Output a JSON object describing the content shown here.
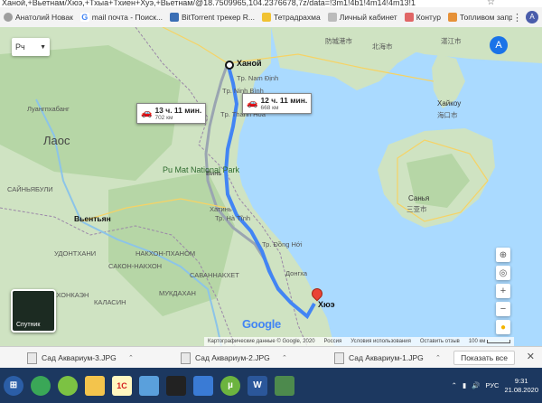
{
  "browser": {
    "url_fragment": "Ханой,+Вьетнам/Хюэ,+Тхыа+Тхиен+Хуэ,+Вьетнам/@18.7509965,104.2376678,7z/data=!3m1!4b1!4m14!4m13!1",
    "bookmarks": [
      {
        "label": "Анатолий Новак",
        "icon": "account-icon",
        "color": "#9e9e9e"
      },
      {
        "label": "mail почта - Поиск...",
        "icon": "google-g-icon",
        "color": "#4285f4"
      },
      {
        "label": "BitTorrent трекер R...",
        "icon": "torrent-icon",
        "color": "#3b6fb5"
      },
      {
        "label": "Тетрадрахма",
        "icon": "folder-icon",
        "color": "#f1c232"
      },
      {
        "label": "Личный кабинет",
        "icon": "link-icon",
        "color": "#777777"
      },
      {
        "label": "Контур",
        "icon": "kontur-icon",
        "color": "#e06666"
      },
      {
        "label": "Топливом заправи...",
        "icon": "fuel-icon",
        "color": "#e69138"
      }
    ],
    "profile_initial": "A"
  },
  "map": {
    "map_type_selector": "Рч",
    "profile_initial": "A",
    "labels": {
      "hanoi": "Ханой",
      "hue": "Хюэ",
      "laos": "Лаос",
      "vientiane": "Вьентьян",
      "luangprabang": "Луангпхабанг",
      "sanya": "Санья",
      "haikou": "Хайкоу",
      "vinh": "Винь",
      "pumat": "Pu Mat National Park",
      "dong_hoi": "Тр. Đồng Hới",
      "dong_ha": "Донгха",
      "ha_tinh": "Тр. Hà Tĩnh",
      "hatin": "Хатинь",
      "thanh_hoa": "Tp. Thanh Hóa",
      "nam_dinh": "Tp. Nam Định",
      "ninh_binh": "Tp. Ninh Bình",
      "khanhhoa": "САКОН-НАКХОН",
      "mukdahan": "МУКДАХАН",
      "nakhon": "НАКХОН-ПХАНОМ",
      "savannakhet": "САВАННАКХЕТ",
      "udon": "УДОНТХАНИ",
      "kalasin": "КАЛАСИН",
      "khonkaen": "КХОНКАЭН",
      "sainyabuli": "САЙНЬЯБУЛИ",
      "zhanjiang": "湛江市",
      "haikou_cn": "海口市",
      "sanya_cn": "三亚市",
      "beihai": "北海市",
      "fangcheng": "防城港市"
    },
    "route_primary": {
      "duration": "12 ч. 11 мин.",
      "distance": "668 км"
    },
    "route_alt": {
      "duration": "13 ч. 11 мин.",
      "distance": "702 км"
    },
    "satellite_label": "Спутник",
    "google_logo": "Google",
    "footer": {
      "map_data": "Картографические данные © Google, 2020",
      "country": "Россия",
      "terms": "Условия использования",
      "feedback": "Оставить отзыв",
      "scale": "100 км"
    },
    "colors": {
      "route": "#4285f4",
      "alt_route": "#9aa5b1",
      "land": "#cfe3c2",
      "water": "#aadaff",
      "pin": "#ea4335"
    }
  },
  "downloads": {
    "items": [
      "Сад Аквариум-3.JPG",
      "Сад Аквариум-2.JPG",
      "Сад Аквариум-1.JPG"
    ],
    "show_all": "Показать все"
  },
  "taskbar": {
    "lang": "РУС",
    "time": "9:31",
    "date": "21.08.2020"
  }
}
